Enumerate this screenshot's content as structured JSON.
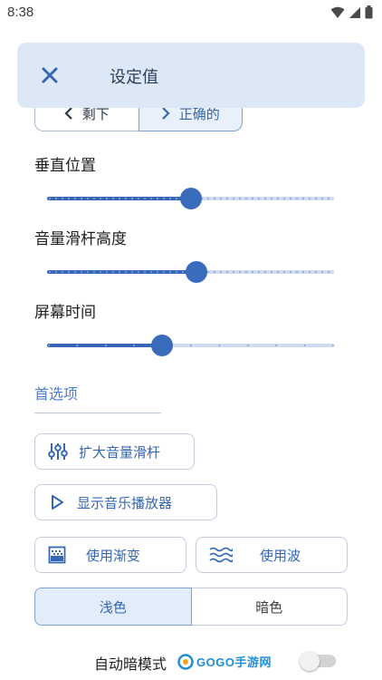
{
  "status_bar": {
    "time": "8:38"
  },
  "header": {
    "title": "设定值"
  },
  "top_segment": {
    "prev_label": "剩下",
    "next_label": "正确的"
  },
  "sliders": [
    {
      "label": "垂直位置",
      "value": 0.5
    },
    {
      "label": "音量滑杆高度",
      "value": 0.52
    },
    {
      "label": "屏幕时间",
      "value": 0.4
    }
  ],
  "preferences": {
    "section_title": "首选项",
    "expand_volume_slider": "扩大音量滑杆",
    "show_music_player": "显示音乐播放器",
    "use_gradient": "使用渐变",
    "use_wave": "使用波"
  },
  "theme": {
    "light": "浅色",
    "dark": "暗色",
    "selected": "light"
  },
  "auto_dark": {
    "label": "自动暗模式",
    "enabled": false
  },
  "watermark": {
    "text": "GOGO手游网"
  },
  "colors": {
    "accent": "#3567b5",
    "header_bg": "#dde8f7",
    "track": "#cfdbf0"
  }
}
